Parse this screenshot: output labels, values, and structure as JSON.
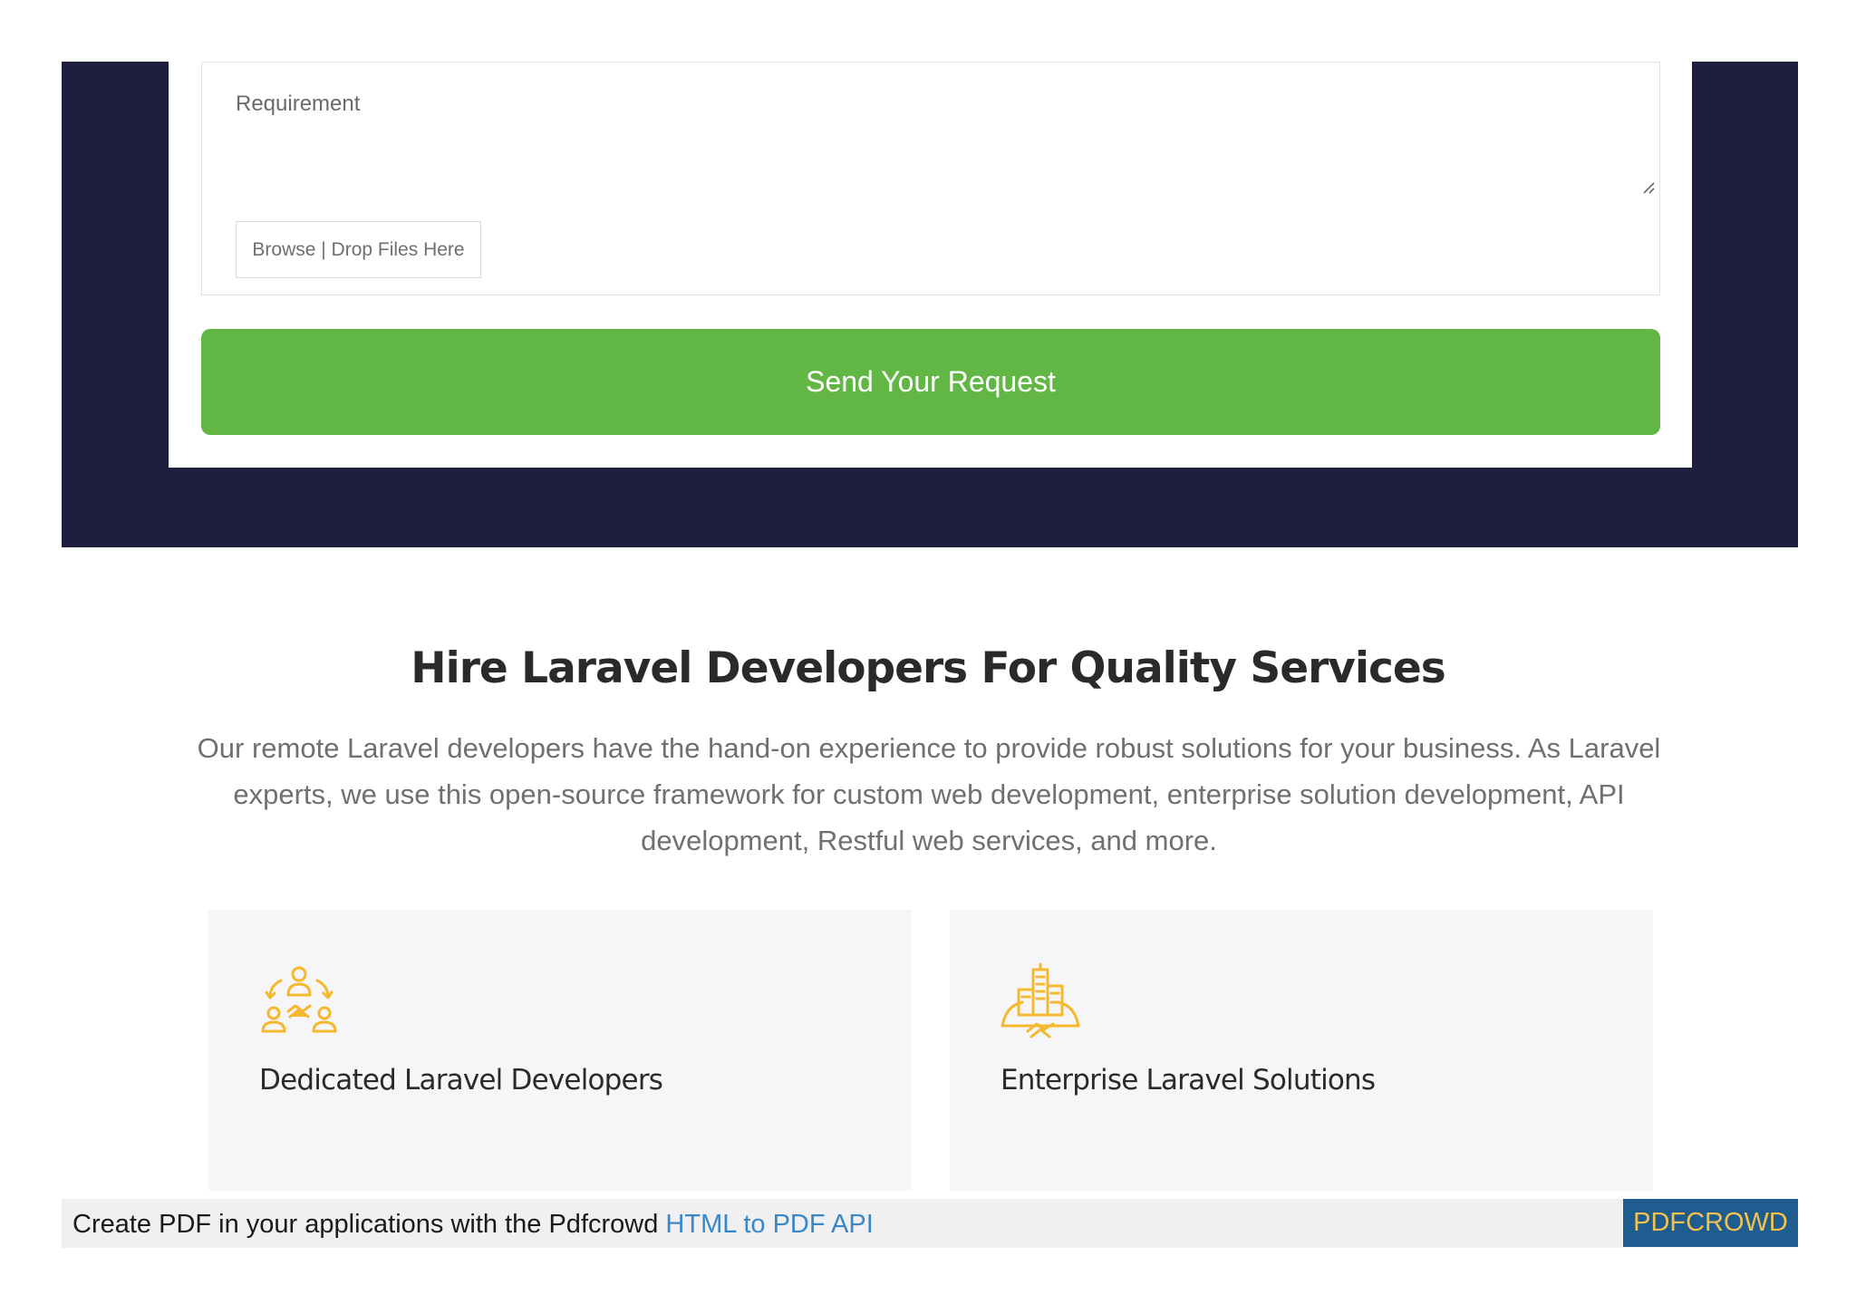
{
  "form": {
    "requirement_placeholder": "Requirement",
    "browse_label": "Browse | Drop Files Here",
    "submit_label": "Send Your Request"
  },
  "section": {
    "title": "Hire Laravel Developers For Quality Services",
    "description": "Our remote Laravel developers have the hand-on experience to provide robust solutions for your business. As Laravel experts, we use this open-source framework for custom web development, enterprise solution development, API development, Restful web services, and more."
  },
  "cards": [
    {
      "title": "Dedicated Laravel Developers",
      "icon": "team-collaboration-icon"
    },
    {
      "title": "Enterprise Laravel Solutions",
      "icon": "enterprise-building-icon"
    }
  ],
  "footer_bar": {
    "text": "Create PDF in your applications with the Pdfcrowd ",
    "link": "HTML to PDF API",
    "brand": "PDFCROWD"
  },
  "colors": {
    "dark_band": "#1e1f3e",
    "submit_green": "#62b744",
    "icon_amber": "#f5b82e",
    "brand_blue": "#1f5c8f",
    "brand_text": "#f2c14e",
    "link_blue": "#3a87c8"
  }
}
